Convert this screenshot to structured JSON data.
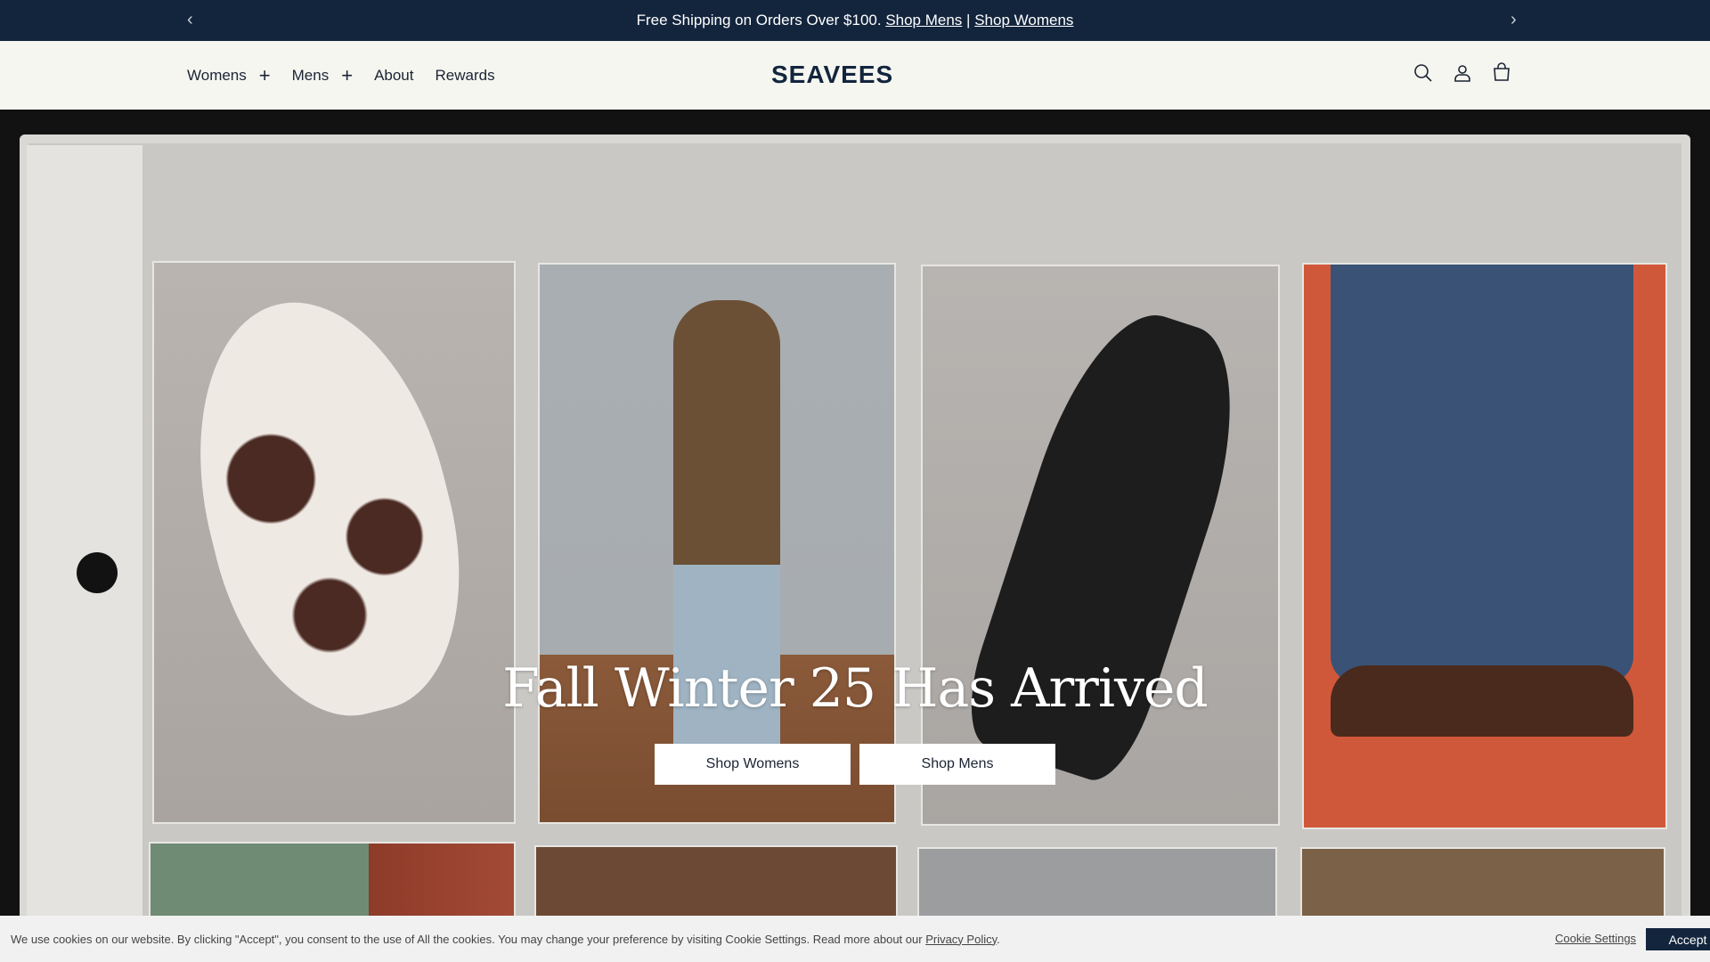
{
  "announcement": {
    "text": "Free Shipping on Orders Over $100.",
    "link_mens": "Shop Mens",
    "separator": "|",
    "link_womens": "Shop Womens",
    "prev_arrow": "‹",
    "next_arrow": "›"
  },
  "header": {
    "nav": [
      {
        "label": "Womens",
        "expand": "+"
      },
      {
        "label": "Mens",
        "expand": "+"
      },
      {
        "label": "About"
      },
      {
        "label": "Rewards"
      }
    ],
    "logo_text": "SEAVEES",
    "icons": [
      "search-icon",
      "account-icon",
      "cart-icon"
    ]
  },
  "hero": {
    "title": "Fall Winter 25 Has Arrived",
    "buttons": [
      "Shop Womens",
      "Shop Mens"
    ]
  },
  "cookie": {
    "message": "We use cookies on our website. By clicking \"Accept\", you consent to the use of All the cookies. You may change your preference by visiting Cookie Settings. Read more about our",
    "privacy_link": "Privacy Policy",
    "period": ".",
    "settings": "Cookie Settings",
    "accept": "Accept"
  },
  "colors": {
    "navy": "#13253d",
    "header_bg": "#f6f6f1",
    "hero_bg": "#121212"
  }
}
